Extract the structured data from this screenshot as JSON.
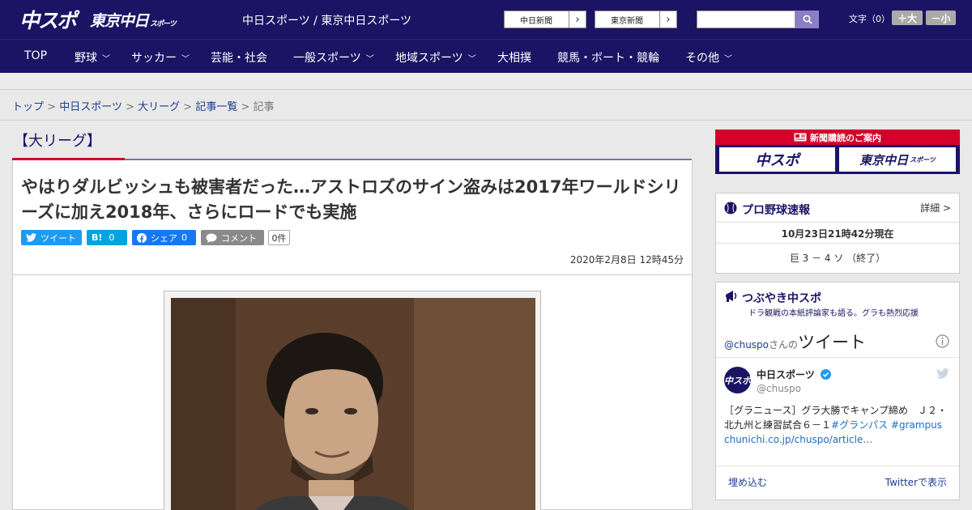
{
  "header": {
    "logo_primary": "中スポ",
    "logo_secondary": "東京中日",
    "logo_secondary_sub": "スポーツ",
    "site_links": "中日スポーツ / 東京中日スポーツ",
    "paper_links": [
      {
        "label": "中日新聞"
      },
      {
        "label": "東京新聞"
      }
    ],
    "search": {
      "value": "",
      "placeholder": ""
    },
    "text_size_label": "文字（0）",
    "text_size_up": "＋大",
    "text_size_down": "－小"
  },
  "nav": [
    {
      "label": "TOP",
      "has_menu": false
    },
    {
      "label": "野球",
      "has_menu": true
    },
    {
      "label": "サッカー",
      "has_menu": true
    },
    {
      "label": "芸能・社会",
      "has_menu": false
    },
    {
      "label": "一般スポーツ",
      "has_menu": true
    },
    {
      "label": "地域スポーツ",
      "has_menu": true
    },
    {
      "label": "大相撲",
      "has_menu": false
    },
    {
      "label": "競馬・ボート・競輪",
      "has_menu": false
    },
    {
      "label": "その他",
      "has_menu": true
    }
  ],
  "breadcrumb": {
    "items": [
      "トップ",
      "中日スポーツ",
      "大リーグ",
      "記事一覧"
    ],
    "current": "記事",
    "separator": ">"
  },
  "article": {
    "category": "【大リーグ】",
    "headline": "やはりダルビッシュも被害者だった…アストロズのサイン盗みは2017年ワールドシリーズに加え2018年、さらにロードでも実施",
    "share": {
      "tweet": "ツイート",
      "hatena_label": "B!",
      "hatena_count": "0",
      "facebook_label": "シェア",
      "facebook_count": "0",
      "comment_label": "コメント",
      "comment_count": "0件"
    },
    "date": "2020年2月8日 12時45分"
  },
  "sidebar": {
    "subscribe": {
      "title": "新聞購読のご案内",
      "logo_left": "中スポ",
      "logo_right": "東京中日",
      "logo_right_sub": "スポーツ"
    },
    "baseball": {
      "title": "プロ野球速報",
      "detail": "詳細 >",
      "time": "10月23日21時42分現在",
      "score": "巨 3 － 4 ソ （終了）"
    },
    "twitter": {
      "title": "つぶやき中スポ",
      "subtitle": "ドラ観戦の本紙評論家も語る。グラも熱烈応援",
      "handle": "@chuspo",
      "handle_suffix": "さんの",
      "tweets_label": "ツイート",
      "account_name": "中日スポーツ",
      "account_handle": "@chuspo",
      "avatar_text": "中スポ",
      "tweet_text": "［グラニュース］グラ大勝でキャンプ締め　Ｊ２・北九州と練習試合６－１",
      "hashtag1": "#グランパス",
      "hashtag2": "#grampus",
      "link": "chunichi.co.jp/chuspo/article…",
      "embed": "埋め込む",
      "view_on": "Twitterで表示"
    }
  },
  "colors": {
    "brand_navy": "#1b1464",
    "accent_red": "#d4002a",
    "twitter_blue": "#1d9bf0",
    "hatena_blue": "#00a4de",
    "facebook_blue": "#1877f2",
    "comment_gray": "#8a8a8a"
  }
}
